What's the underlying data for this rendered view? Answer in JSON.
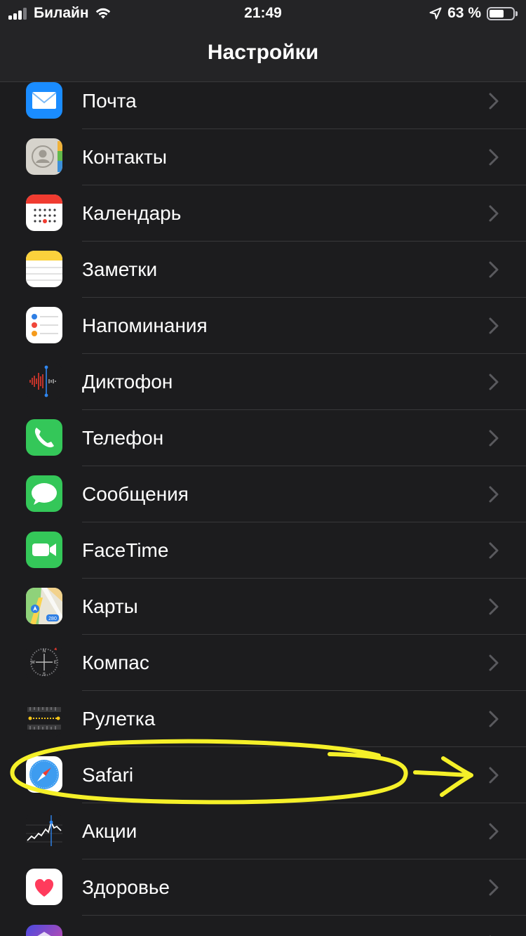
{
  "status_bar": {
    "carrier": "Билайн",
    "time": "21:49",
    "battery": "63 %",
    "battery_level": 0.63
  },
  "nav": {
    "title": "Настройки"
  },
  "items": [
    {
      "label": "Почта",
      "icon": "mail-icon"
    },
    {
      "label": "Контакты",
      "icon": "contacts-icon"
    },
    {
      "label": "Календарь",
      "icon": "calendar-icon"
    },
    {
      "label": "Заметки",
      "icon": "notes-icon"
    },
    {
      "label": "Напоминания",
      "icon": "reminders-icon"
    },
    {
      "label": "Диктофон",
      "icon": "voice-memos-icon"
    },
    {
      "label": "Телефон",
      "icon": "phone-icon"
    },
    {
      "label": "Сообщения",
      "icon": "messages-icon"
    },
    {
      "label": "FaceTime",
      "icon": "facetime-icon"
    },
    {
      "label": "Карты",
      "icon": "maps-icon"
    },
    {
      "label": "Компас",
      "icon": "compass-icon"
    },
    {
      "label": "Рулетка",
      "icon": "measure-icon"
    },
    {
      "label": "Safari",
      "icon": "safari-icon"
    },
    {
      "label": "Акции",
      "icon": "stocks-icon"
    },
    {
      "label": "Здоровье",
      "icon": "health-icon"
    },
    {
      "label": "",
      "icon": "shortcuts-icon"
    }
  ],
  "colors": {
    "background": "#1c1c1e",
    "separator": "#38383a",
    "chevron": "#5a5a5e",
    "annotation": "#f5f029"
  }
}
